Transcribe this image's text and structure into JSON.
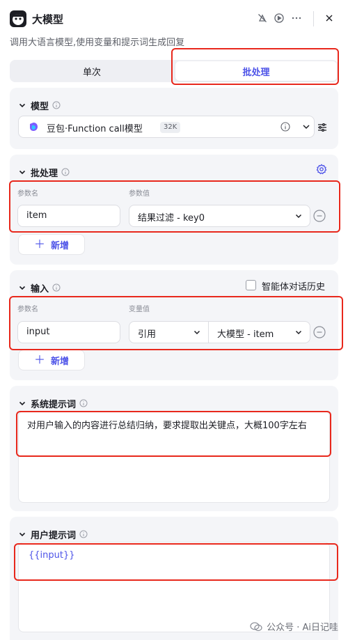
{
  "header": {
    "title": "大模型",
    "subtitle": "调用大语言模型,使用变量和提示词生成回复"
  },
  "tabs": [
    {
      "label": "单次",
      "active": false
    },
    {
      "label": "批处理",
      "active": true
    }
  ],
  "model_section": {
    "title": "模型",
    "model_name": "豆包·Function call模型",
    "context_badge": "32K"
  },
  "batch_section": {
    "title": "批处理",
    "col_name": "参数名",
    "col_value": "参数值",
    "param_name": "item",
    "param_value": "结果过滤 - key0",
    "add_label": "新增"
  },
  "input_section": {
    "title": "输入",
    "history_label": "智能体对话历史",
    "col_name": "参数名",
    "col_value": "变量值",
    "param_name": "input",
    "value_type": "引用",
    "value_ref": "大模型 - item",
    "add_label": "新增"
  },
  "system_prompt": {
    "title": "系统提示词",
    "text": "对用户输入的内容进行总结归纳，要求提取出关键点，大概100字左右"
  },
  "user_prompt": {
    "title": "用户提示词",
    "text": "{{input}}"
  },
  "watermark": "公众号 · Ai日记哇",
  "colors": {
    "accent": "#4d53e8",
    "highlight_border": "#e8281c",
    "card_bg": "#f4f5f8"
  }
}
